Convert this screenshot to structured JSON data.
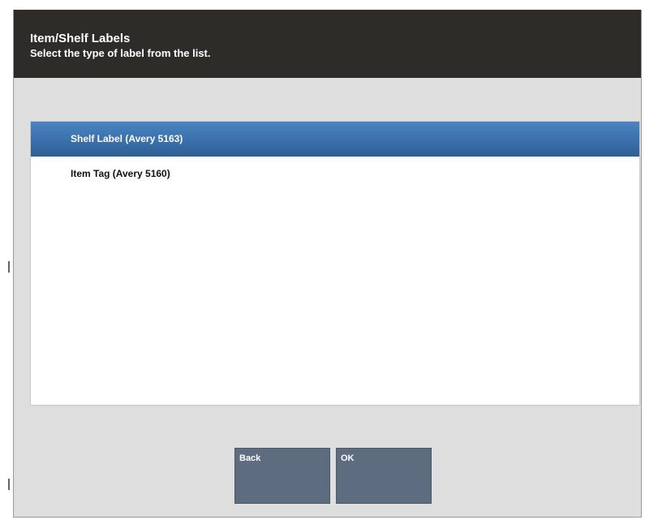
{
  "header": {
    "title": "Item/Shelf Labels",
    "subtitle": "Select the type of label from the list."
  },
  "list": {
    "items": [
      {
        "label": "Shelf Label (Avery 5163)",
        "selected": true
      },
      {
        "label": "Item Tag (Avery 5160)",
        "selected": false
      }
    ]
  },
  "buttons": {
    "back_label": "Back",
    "ok_label": "OK"
  },
  "colors": {
    "header_bg": "#2e2c28",
    "selection": "#3a70ab",
    "button_bg": "#5d6c7f",
    "dialog_bg": "#dedede"
  }
}
